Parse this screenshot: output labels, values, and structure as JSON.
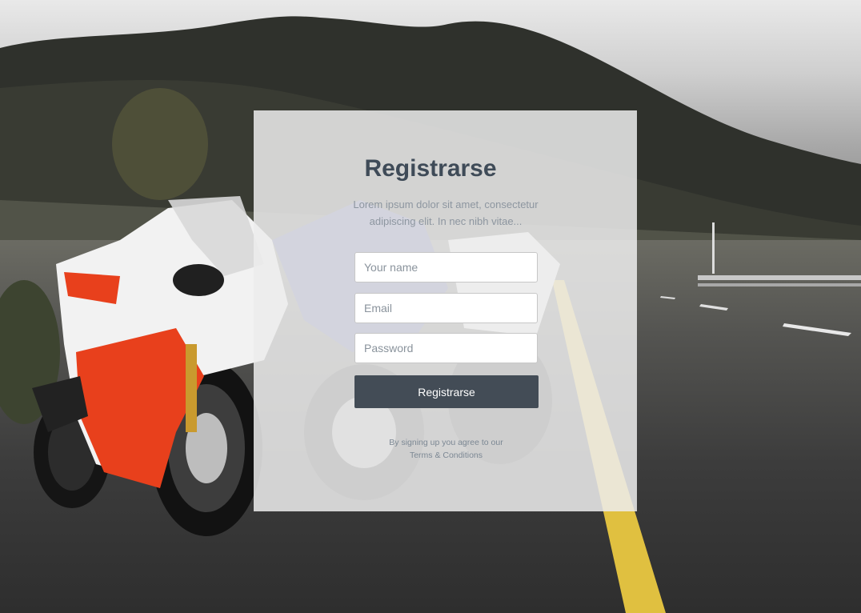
{
  "form": {
    "title": "Registrarse",
    "description": "Lorem ipsum dolor sit amet, consectetur adipiscing elit. In nec nibh vitae...",
    "name_placeholder": "Your name",
    "email_placeholder": "Email",
    "password_placeholder": "Password",
    "submit_label": "Registrarse",
    "terms_prefix": "By signing up you agree to our",
    "terms_link": "Terms & Conditions"
  },
  "colors": {
    "card_background": "#ececec",
    "title": "#3f4b58",
    "button": "#434c56",
    "road_line": "#e0c040",
    "motorcycle_red": "#e8401c"
  }
}
